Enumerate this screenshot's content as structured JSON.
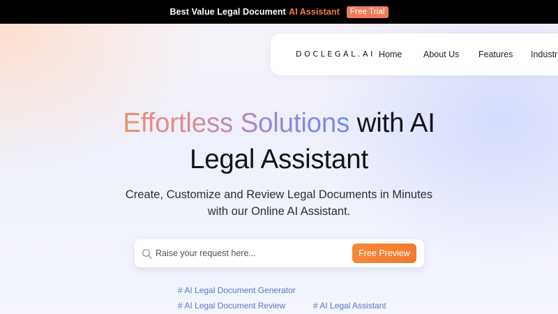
{
  "promo": {
    "text": "Best Value Legal Document",
    "accent": "AI Assistant",
    "badge": "Free Trial"
  },
  "nav": {
    "logo": "DOCLEGAL.AI",
    "links": [
      "Home",
      "About Us",
      "Features",
      "Industries"
    ]
  },
  "hero": {
    "gradient_text": "Effortless Solutions",
    "rest_line1": "with AI",
    "line2": "Legal Assistant",
    "subtitle_line1": "Create, Customize and Review Legal Documents in Minutes",
    "subtitle_line2": "with our Online AI Assistant."
  },
  "search": {
    "placeholder": "Raise your request here...",
    "button_label": "Free Preview"
  },
  "tags": [
    "# AI Legal Document Generator",
    "# AI Legal Document Review",
    "# AI Legal Assistant"
  ],
  "colors": {
    "accent_orange": "#f47c4a",
    "button_orange": "#f6883a",
    "tag_blue": "#5b78c8"
  }
}
